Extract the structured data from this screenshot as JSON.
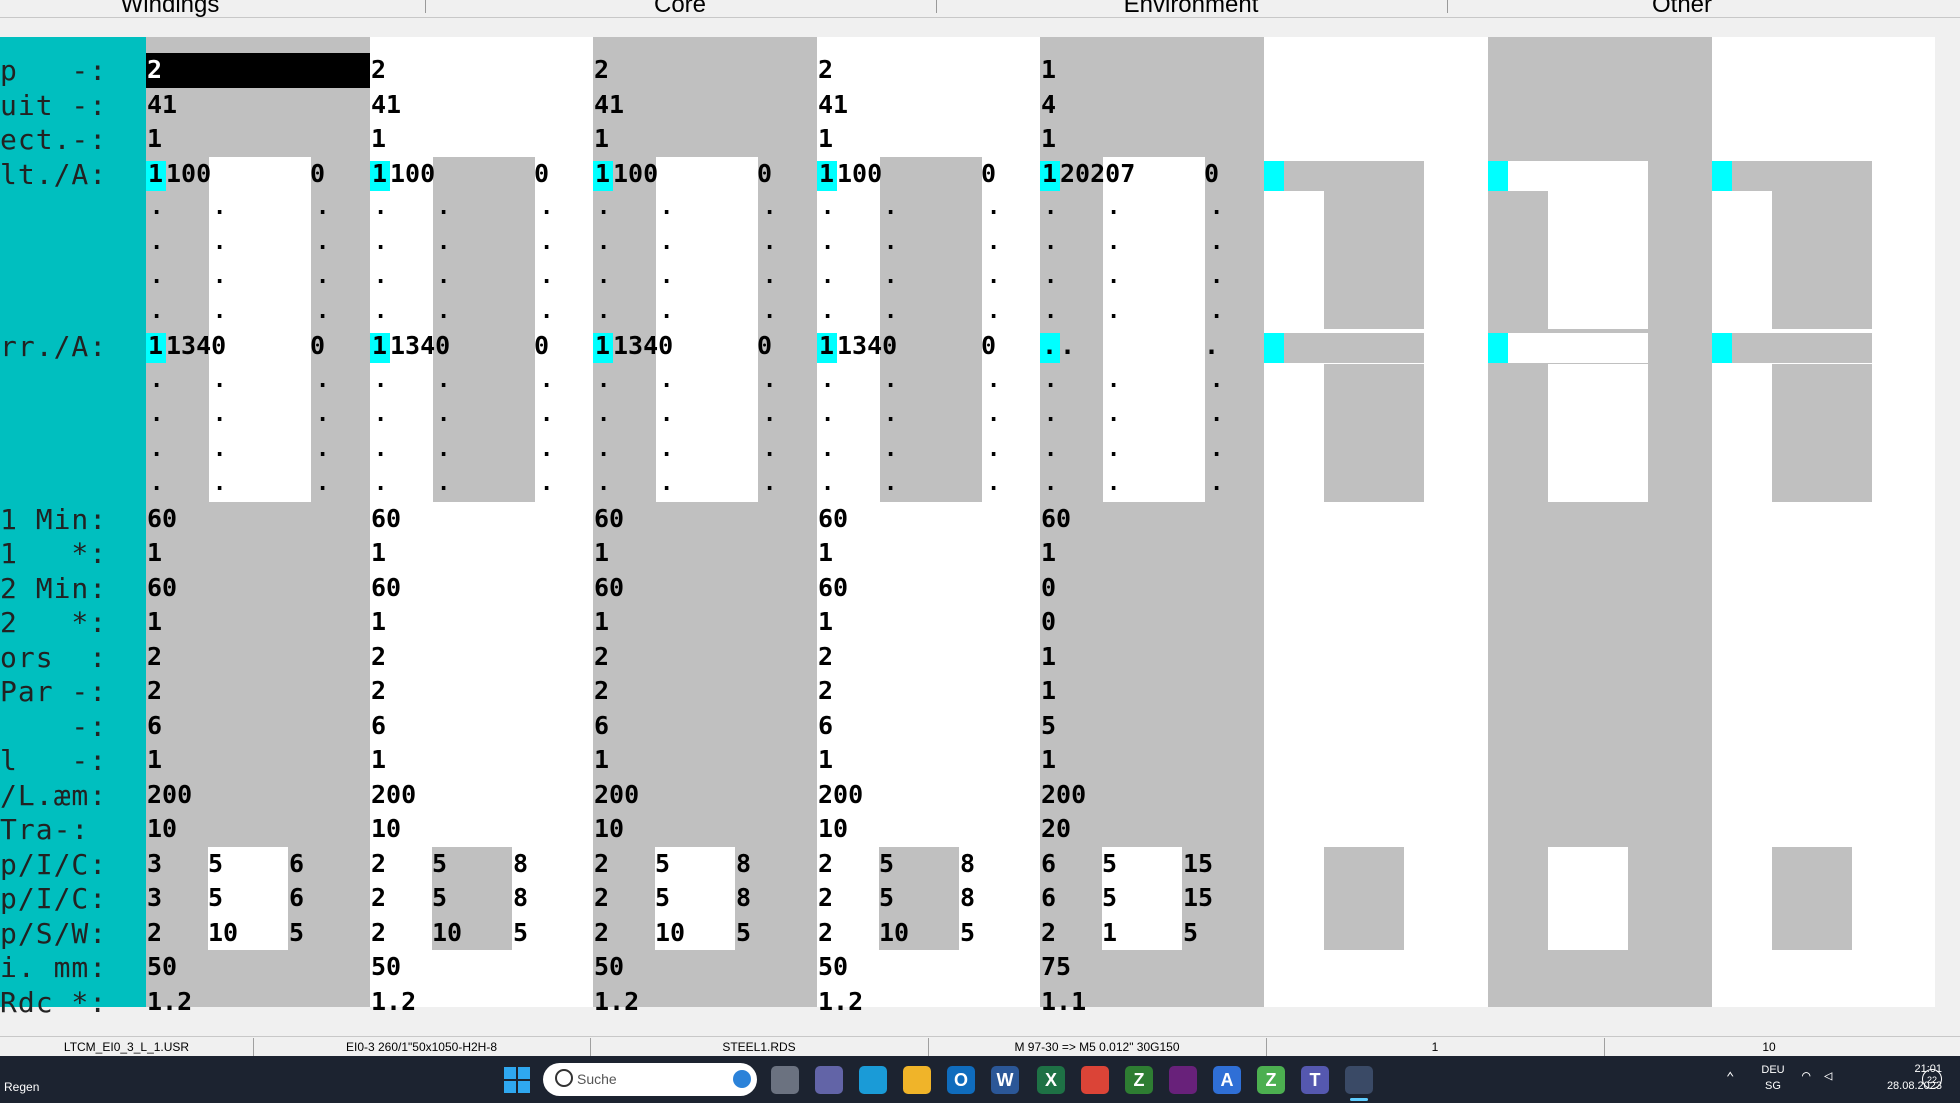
{
  "tabs": [
    "Windings",
    "Core",
    "Environment",
    "Other"
  ],
  "row_labels": [
    "p   -:",
    "uit -:",
    "ect.-:",
    "lt./A:",
    "",
    "",
    "",
    "",
    "rr./A:",
    "",
    "",
    "",
    "",
    "1 Min:",
    "1   *:",
    "2 Min:",
    "2   *:",
    "ors  :",
    "Par -:",
    "    -:",
    "l   -:",
    "/L.æm:",
    "Tra-:",
    "p/I/C:",
    "p/I/C:",
    "p/S/W:",
    "i. mm:",
    "Rdc *:"
  ],
  "columns": [
    {
      "p": "2",
      "uit": "41",
      "ect": "1",
      "lt_n": "1",
      "lt_v": "100",
      "lt_z": "0",
      "rr_n": "1",
      "rr_v": "1340",
      "rr_z": "0",
      "min1": "60",
      "s1": "1",
      "min2": "60",
      "s2": "1",
      "ors": "2",
      "par": "2",
      "dash": "6",
      "l": "1",
      "lam": "200",
      "tra": "10",
      "pic1": [
        "3",
        "5",
        "6"
      ],
      "pic2": [
        "3",
        "5",
        "6"
      ],
      "psw": [
        "2",
        "10",
        "5"
      ],
      "imm": "50",
      "rdc": "1.2"
    },
    {
      "p": "2",
      "uit": "41",
      "ect": "1",
      "lt_n": "1",
      "lt_v": "100",
      "lt_z": "0",
      "rr_n": "1",
      "rr_v": "1340",
      "rr_z": "0",
      "min1": "60",
      "s1": "1",
      "min2": "60",
      "s2": "1",
      "ors": "2",
      "par": "2",
      "dash": "6",
      "l": "1",
      "lam": "200",
      "tra": "10",
      "pic1": [
        "2",
        "5",
        "8"
      ],
      "pic2": [
        "2",
        "5",
        "8"
      ],
      "psw": [
        "2",
        "10",
        "5"
      ],
      "imm": "50",
      "rdc": "1.2"
    },
    {
      "p": "2",
      "uit": "41",
      "ect": "1",
      "lt_n": "1",
      "lt_v": "100",
      "lt_z": "0",
      "rr_n": "1",
      "rr_v": "1340",
      "rr_z": "0",
      "min1": "60",
      "s1": "1",
      "min2": "60",
      "s2": "1",
      "ors": "2",
      "par": "2",
      "dash": "6",
      "l": "1",
      "lam": "200",
      "tra": "10",
      "pic1": [
        "2",
        "5",
        "8"
      ],
      "pic2": [
        "2",
        "5",
        "8"
      ],
      "psw": [
        "2",
        "10",
        "5"
      ],
      "imm": "50",
      "rdc": "1.2"
    },
    {
      "p": "2",
      "uit": "41",
      "ect": "1",
      "lt_n": "1",
      "lt_v": "100",
      "lt_z": "0",
      "rr_n": "1",
      "rr_v": "1340",
      "rr_z": "0",
      "min1": "60",
      "s1": "1",
      "min2": "60",
      "s2": "1",
      "ors": "2",
      "par": "2",
      "dash": "6",
      "l": "1",
      "lam": "200",
      "tra": "10",
      "pic1": [
        "2",
        "5",
        "8"
      ],
      "pic2": [
        "2",
        "5",
        "8"
      ],
      "psw": [
        "2",
        "10",
        "5"
      ],
      "imm": "50",
      "rdc": "1.2"
    },
    {
      "p": "1",
      "uit": "4",
      "ect": "1",
      "lt_n": "1",
      "lt_v": "20207",
      "lt_z": "0",
      "rr_n": ".",
      "rr_v": ".",
      "rr_z": ".",
      "min1": "60",
      "s1": "1",
      "min2": "0",
      "s2": "0",
      "ors": "1",
      "par": "1",
      "dash": "5",
      "l": "1",
      "lam": "200",
      "tra": "20",
      "pic1": [
        "6",
        "5",
        "15"
      ],
      "pic2": [
        "6",
        "5",
        "15"
      ],
      "psw": [
        "2",
        "1",
        "5"
      ],
      "imm": "75",
      "rdc": "1.1"
    }
  ],
  "dot_char": ".",
  "status": [
    "LTCM_EI0_3_L_1.USR",
    "EI0-3 260/1\"50x1050-H2H-8",
    "STEEL1.RDS",
    "M 97-30 => M5 0.012\" 30G150",
    "1",
    "10"
  ],
  "taskbar": {
    "weather": "Regen",
    "search_placeholder": "Suche",
    "lang": "DEU",
    "region": "SG",
    "time": "21:01",
    "date": "28.08.2023",
    "notifications": "22"
  },
  "colors": {
    "label_bg": "#00bfbf",
    "gray": "#c0c0c0",
    "cyan": "#00ffff",
    "selected": "#000000"
  }
}
